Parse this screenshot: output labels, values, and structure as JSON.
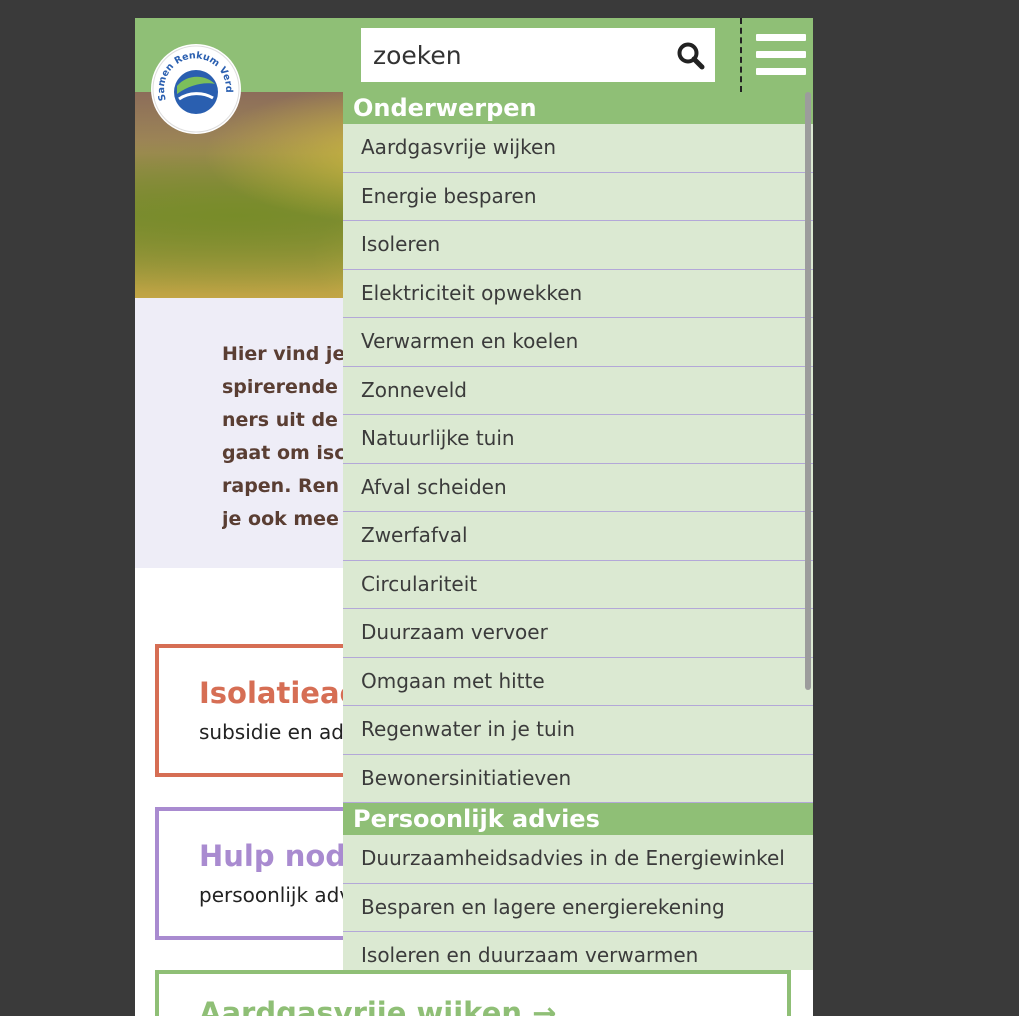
{
  "search": {
    "placeholder": "zoeken"
  },
  "logo": {
    "text": "Samen Renkum Verduurzaamt"
  },
  "intro": {
    "lines": [
      "Hier vind je",
      "spirerende",
      "ners uit de",
      "gaat om isc",
      "rapen. Ren",
      "je ook mee"
    ]
  },
  "cards": [
    {
      "title": "Isolatieactie",
      "subtitle": "subsidie en advies",
      "color": "#d66e54"
    },
    {
      "title": "Hulp nodig?",
      "subtitle": "persoonlijk advies",
      "color": "#a98bd0"
    },
    {
      "title": "Aardgasvrije wijken →",
      "subtitle": "",
      "color": "#8fbf76"
    }
  ],
  "menu": {
    "sections": [
      {
        "title": "Onderwerpen",
        "items": [
          "Aardgasvrije wijken",
          "Energie besparen",
          "Isoleren",
          "Elektriciteit opwekken",
          "Verwarmen en koelen",
          "Zonneveld",
          "Natuurlijke tuin",
          "Afval scheiden",
          "Zwerfafval",
          "Circulariteit",
          "Duurzaam vervoer",
          "Omgaan met hitte",
          "Regenwater in je tuin",
          "Bewonersinitiatieven"
        ]
      },
      {
        "title": "Persoonlijk advies",
        "items": [
          "Duurzaamheidsadvies in de Energiewinkel",
          "Besparen en lagere energierekening",
          "Isoleren en duurzaam verwarmen"
        ]
      }
    ]
  },
  "colors": {
    "brand_green": "#8fbf76",
    "menu_bg": "#dbe9d2",
    "intro_bg": "#eeedf7",
    "intro_text": "#5a3e33",
    "divider": "#b3a8d8",
    "logo_blue": "#2a5fb0"
  },
  "icons": {
    "search": "search-icon",
    "menu": "hamburger-icon"
  }
}
